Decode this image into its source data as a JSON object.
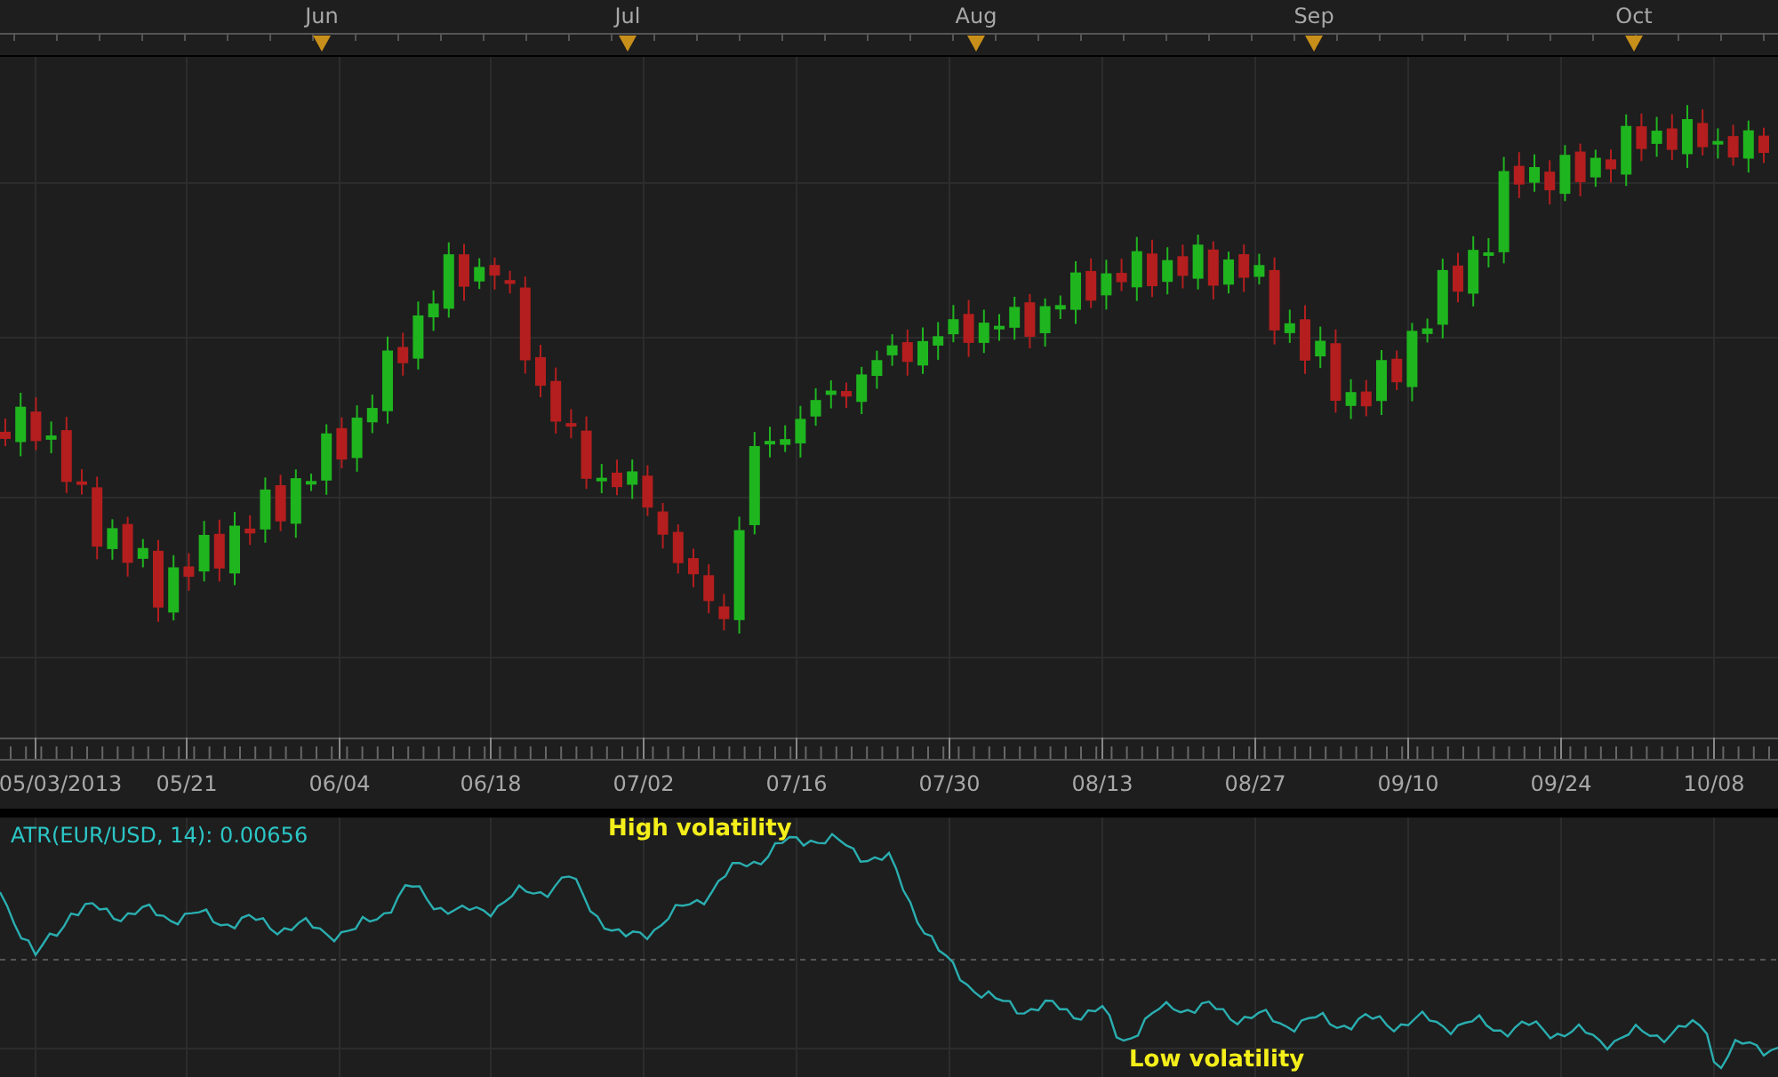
{
  "top_axis": {
    "months": [
      {
        "label": "Jun"
      },
      {
        "label": "Jul"
      },
      {
        "label": "Aug"
      },
      {
        "label": "Sep"
      },
      {
        "label": "Oct"
      }
    ]
  },
  "date_axis": {
    "dates": [
      "05/03/2013",
      "05/21",
      "06/04",
      "06/18",
      "07/02",
      "07/16",
      "07/30",
      "08/13",
      "08/27",
      "09/10",
      "09/24",
      "10/08"
    ]
  },
  "indicator": {
    "label": "ATR(EUR/USD, 14): 0.00656",
    "annotations": [
      "High volatility",
      "Low volatility"
    ]
  }
}
